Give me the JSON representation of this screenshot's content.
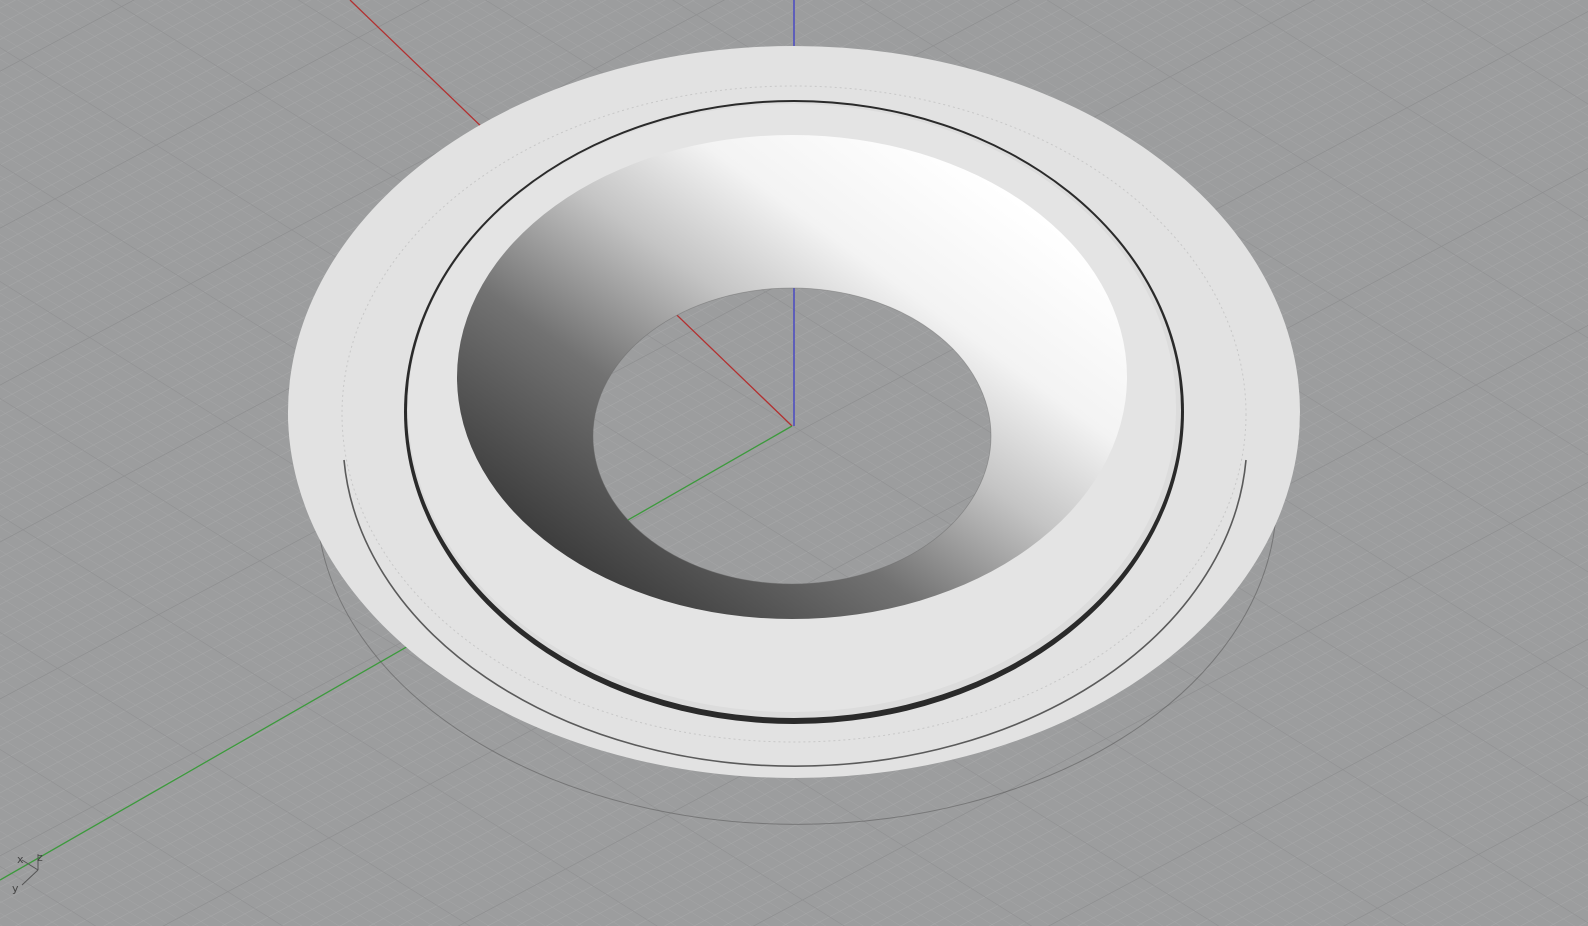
{
  "viewport": {
    "background": "#9c9d9e",
    "grid_minor_color": "#a4a5a6",
    "grid_major_color": "#8e8f90",
    "axis_colors": {
      "x": "#b23030",
      "y": "#3c9a3c",
      "z": "#3c3cc8"
    }
  },
  "model": {
    "object": "ring-part-with-conical-bore",
    "face_color": "#e1e1e1",
    "groove_color": "#2a2a2a"
  },
  "axis_gizmo": {
    "x_label": "x",
    "y_label": "y",
    "z_label": "z",
    "icon": "axis-triad-icon"
  }
}
